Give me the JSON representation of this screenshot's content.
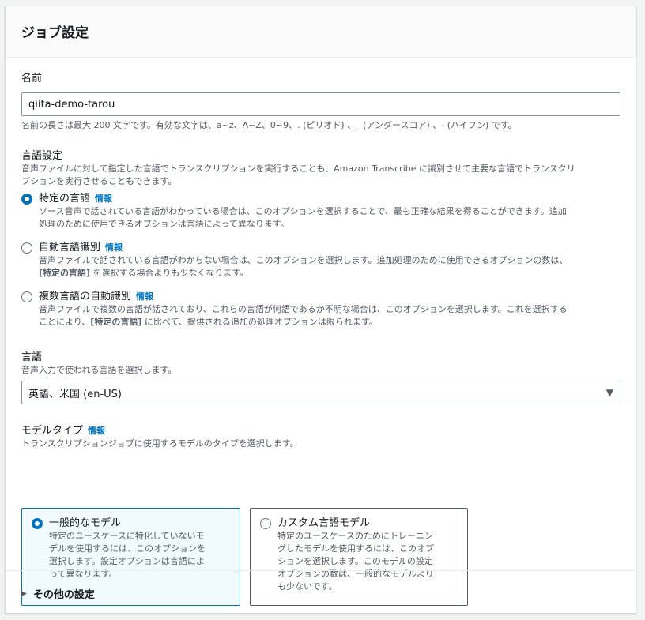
{
  "panel": {
    "title": "ジョブ設定"
  },
  "name_field": {
    "label": "名前",
    "value": "qiita-demo-tarou",
    "hint": "名前の長さは最大 200 文字です。有効な文字は、a~z、A~Z、0~9、. (ピリオド) 、_ (アンダースコア) 、- (ハイフン) です。"
  },
  "language_settings": {
    "label": "言語設定",
    "description_line1": "音声ファイルに対して指定した言語でトランスクリプションを実行することも、Amazon Transcribe に識別させて主要な言語でトランスクリ",
    "description_line2": "プションを実行させることもできます。",
    "options": [
      {
        "label": "特定の言語",
        "info": "情報",
        "checked": true,
        "desc_line1": "ソース音声で話されている言語がわかっている場合は、このオプションを選択することで、最も正確な結果を得ることができます。追加",
        "desc_line2": "処理のために使用できるオプションは言語によって異なります。"
      },
      {
        "label": "自動言語識別",
        "info": "情報",
        "checked": false,
        "desc_line1": "音声ファイルで話されている言語がわからない場合は、このオプションを選択します。追加処理のために使用できるオプションの数は、",
        "desc_line2_bold": "[特定の言語]",
        "desc_line2_rest": " を選択する場合よりも少なくなります。"
      },
      {
        "label": "複数言語の自動識別",
        "info": "情報",
        "checked": false,
        "desc_line1": "音声ファイルで複数の言語が話されており、これらの言語が何語であるか不明な場合は、このオプションを選択します。これを選択する",
        "desc_line2_pre": "ことにより、",
        "desc_line2_bold": "[特定の言語]",
        "desc_line2_rest": " に比べて、提供される追加の処理オプションは限られます。"
      }
    ]
  },
  "language": {
    "label": "言語",
    "description": "音声入力で使われる言語を選択します。",
    "selected": "英語、米国 (en-US)"
  },
  "model_type": {
    "label": "モデルタイプ",
    "info": "情報",
    "description": "トランスクリプションジョブに使用するモデルのタイプを選択します。",
    "tiles": [
      {
        "label": "一般的なモデル",
        "checked": true,
        "desc_lines": [
          "特定のユースケースに特化していないモ",
          "デルを使用するには、このオプションを",
          "選択します。設定オプションは言語によ",
          "って異なります。"
        ]
      },
      {
        "label": "カスタム言語モデル",
        "checked": false,
        "desc_lines": [
          "特定のユースケースのためにトレーニン",
          "グしたモデルを使用するには、このオプ",
          "ションを選択します。このモデルの設定",
          "オプションの数は、一般的なモデルより",
          "も少ないです。"
        ]
      }
    ]
  },
  "footer": {
    "expander_label": "その他の設定"
  },
  "colors": {
    "accent": "#0073bb",
    "selected_tile_bg": "#f1faff",
    "header_bg": "#fafafa"
  }
}
